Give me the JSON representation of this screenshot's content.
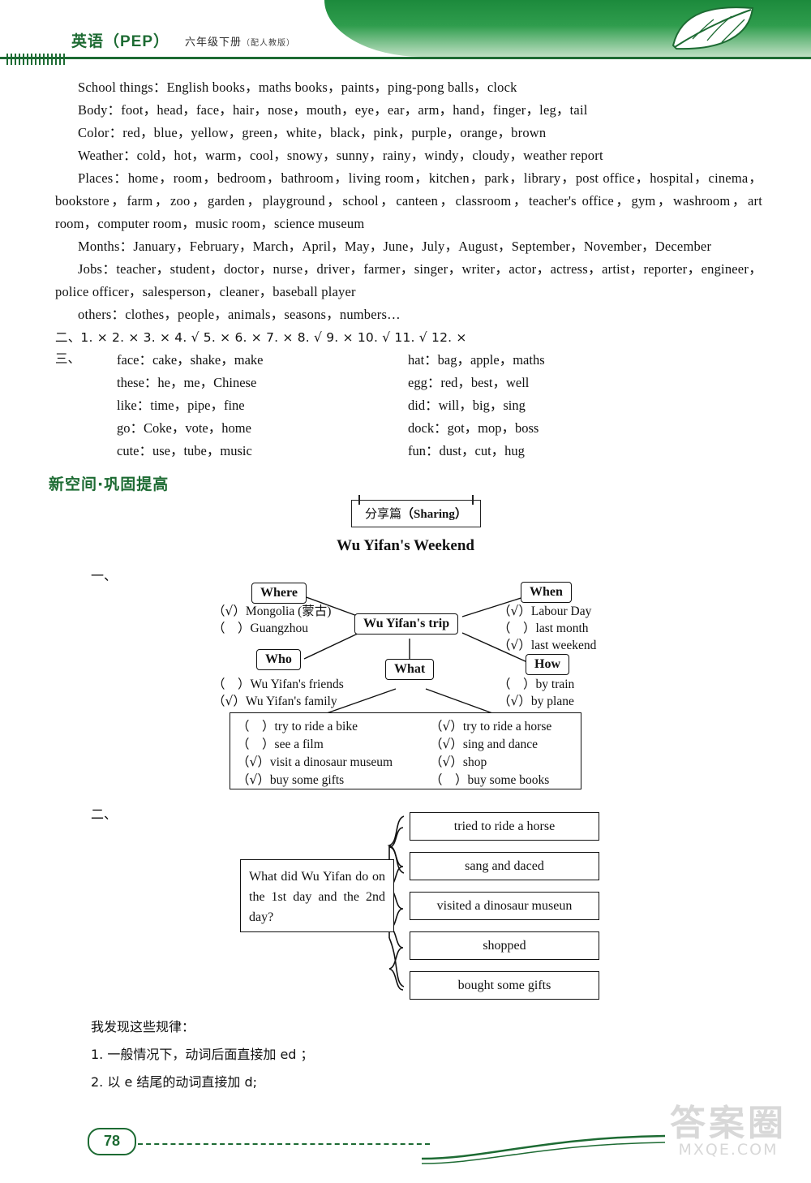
{
  "header": {
    "title": "英语（PEP）",
    "subtitle": "六年级下册",
    "subtitle_small": "（配人教版）"
  },
  "answers": {
    "lines": [
      "School things：English books，maths books，paints，ping-pong balls，clock",
      "Body：foot，head，face，hair，nose，mouth，eye，ear，arm，hand，finger，leg，tail",
      "Color：red，blue，yellow，green，white，black，pink，purple，orange，brown",
      "Weather：cold，hot，warm，cool，snowy，sunny，rainy，windy，cloudy，weather report"
    ],
    "places": "Places：home，room，bedroom，bathroom，living room，kitchen，park，library，post office，hospital，cinema，bookstore，farm，zoo，garden，playground，school，canteen，classroom，teacher's office，gym，washroom，art room，computer room，music room，science museum",
    "months": "Months：January，February，March，April，May，June，July，August，September，November，December",
    "jobs": "Jobs：teacher，student，doctor，nurse，driver，farmer，singer，writer，actor，actress，artist，reporter，engineer，police officer，salesperson，cleaner，baseball player",
    "others": "others：clothes，people，animals，seasons，numbers…",
    "section_two": "二、1. ×  2. ×  3. ×  4. √  5. ×  6. ×  7. ×  8. √  9. ×  10. √  11. √  12. ×",
    "section_three_label": "三、",
    "phonics": [
      {
        "left": "face：cake，shake，make",
        "right": "hat：bag，apple，maths"
      },
      {
        "left": "these：he，me，Chinese",
        "right": "egg：red，best，well"
      },
      {
        "left": "like：time，pipe，fine",
        "right": "did：will，big，sing"
      },
      {
        "left": "go：Coke，vote，home",
        "right": "dock：got，mop，boss"
      },
      {
        "left": "cute：use，tube，music",
        "right": "fun：dust，cut，hug"
      }
    ]
  },
  "banner": "新空间·巩固提高",
  "sharing": {
    "tag_cn": "分享篇",
    "tag_en": "（Sharing）",
    "title": "Wu Yifan's Weekend"
  },
  "ex1": {
    "number": "一、",
    "center": "Wu Yifan's trip",
    "where": {
      "label": "Where",
      "options": [
        {
          "mark": "√",
          "text": "Mongolia (蒙古)"
        },
        {
          "mark": "",
          "text": "Guangzhou"
        }
      ]
    },
    "when": {
      "label": "When",
      "options": [
        {
          "mark": "√",
          "text": "Labour Day"
        },
        {
          "mark": "",
          "text": "last month"
        },
        {
          "mark": "√",
          "text": "last weekend"
        }
      ]
    },
    "who": {
      "label": "Who",
      "options": [
        {
          "mark": "",
          "text": "Wu Yifan's friends"
        },
        {
          "mark": "√",
          "text": "Wu Yifan's family"
        }
      ]
    },
    "how": {
      "label": "How",
      "options": [
        {
          "mark": "",
          "text": "by train"
        },
        {
          "mark": "√",
          "text": "by plane"
        }
      ]
    },
    "what": {
      "label": "What",
      "options_left": [
        {
          "mark": "",
          "text": "try to ride a bike"
        },
        {
          "mark": "",
          "text": "see a film"
        },
        {
          "mark": "√",
          "text": "visit a dinosaur museum"
        },
        {
          "mark": "√",
          "text": "buy some gifts"
        }
      ],
      "options_right": [
        {
          "mark": "√",
          "text": "try to ride a horse"
        },
        {
          "mark": "√",
          "text": "sing and dance"
        },
        {
          "mark": "√",
          "text": "shop"
        },
        {
          "mark": "",
          "text": "buy some books"
        }
      ]
    }
  },
  "ex2": {
    "number": "二、",
    "question": "What did Wu Yifan do on the 1st day and the 2nd day?",
    "items": [
      "tried to ride a horse",
      "sang and daced",
      "visited a dinosaur museun",
      "shopped",
      "bought some gifts"
    ]
  },
  "rules": {
    "heading": "我发现这些规律：",
    "items": [
      "1. 一般情况下，动词后面直接加 ed ；",
      "2. 以 e 结尾的动词直接加 d;"
    ]
  },
  "footer": {
    "page_number": "78",
    "watermark_big": "答案圈",
    "watermark_small": "MXQE.COM"
  }
}
